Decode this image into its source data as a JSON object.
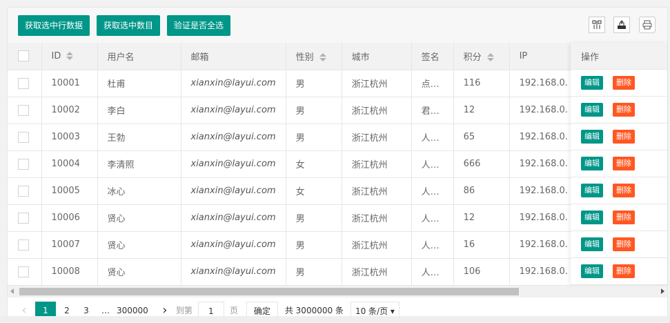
{
  "toolbar": {
    "btn_get_row": "获取选中行数据",
    "btn_get_count": "获取选中数目",
    "btn_check_all": "验证是否全选",
    "icons": [
      "columns-icon",
      "export-icon",
      "print-icon"
    ]
  },
  "table": {
    "headers": {
      "id": "ID",
      "username": "用户名",
      "email": "邮箱",
      "sex": "性别",
      "city": "城市",
      "sign": "签名",
      "score": "积分",
      "ip": "IP",
      "ops": "操作"
    },
    "rows": [
      {
        "id": "10001",
        "username": "杜甫",
        "email": "xianxin@layui.com",
        "sex": "男",
        "city": "浙江杭州",
        "sign": "点…",
        "score": "116",
        "ip": "192.168.0."
      },
      {
        "id": "10002",
        "username": "李白",
        "email": "xianxin@layui.com",
        "sex": "男",
        "city": "浙江杭州",
        "sign": "君…",
        "score": "12",
        "ip": "192.168.0."
      },
      {
        "id": "10003",
        "username": "王勃",
        "email": "xianxin@layui.com",
        "sex": "男",
        "city": "浙江杭州",
        "sign": "人…",
        "score": "65",
        "ip": "192.168.0."
      },
      {
        "id": "10004",
        "username": "李清照",
        "email": "xianxin@layui.com",
        "sex": "女",
        "city": "浙江杭州",
        "sign": "人…",
        "score": "666",
        "ip": "192.168.0."
      },
      {
        "id": "10005",
        "username": "冰心",
        "email": "xianxin@layui.com",
        "sex": "女",
        "city": "浙江杭州",
        "sign": "人…",
        "score": "86",
        "ip": "192.168.0."
      },
      {
        "id": "10006",
        "username": "贤心",
        "email": "xianxin@layui.com",
        "sex": "男",
        "city": "浙江杭州",
        "sign": "人…",
        "score": "12",
        "ip": "192.168.0."
      },
      {
        "id": "10007",
        "username": "贤心",
        "email": "xianxin@layui.com",
        "sex": "男",
        "city": "浙江杭州",
        "sign": "人…",
        "score": "16",
        "ip": "192.168.0."
      },
      {
        "id": "10008",
        "username": "贤心",
        "email": "xianxin@layui.com",
        "sex": "男",
        "city": "浙江杭州",
        "sign": "人…",
        "score": "106",
        "ip": "192.168.0."
      }
    ],
    "edit_label": "编辑",
    "delete_label": "删除"
  },
  "pager": {
    "prev": "‹",
    "pages": [
      "1",
      "2",
      "3"
    ],
    "ellipsis": "…",
    "last": "300000",
    "next": "›",
    "goto_label": "到第",
    "goto_value": "1",
    "page_unit": "页",
    "confirm": "确定",
    "total": "共 3000000 条",
    "page_size": "10 条/页"
  },
  "colors": {
    "primary": "#009688",
    "danger": "#FF5722"
  }
}
